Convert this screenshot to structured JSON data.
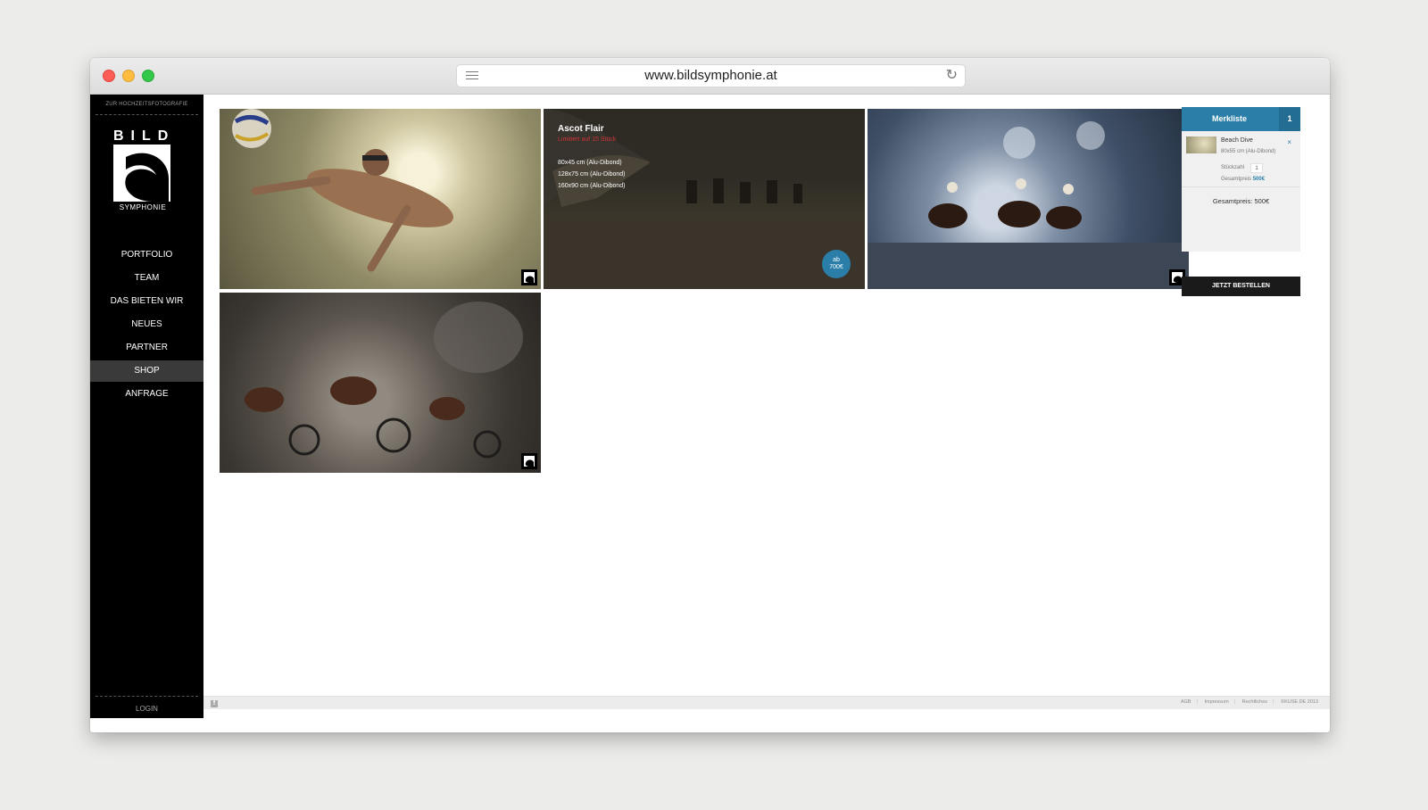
{
  "browser": {
    "url": "www.bildsymphonie.at"
  },
  "sidebar": {
    "wedding_link": "ZUR HOCHZEITSFOTOGRAFIE",
    "logo_top": "BILD",
    "logo_bottom": "SYMPHONIE",
    "nav": [
      {
        "label": "PORTFOLIO"
      },
      {
        "label": "TEAM"
      },
      {
        "label": "DAS BIETEN WIR"
      },
      {
        "label": "NEUES"
      },
      {
        "label": "PARTNER"
      },
      {
        "label": "SHOP",
        "active": true
      },
      {
        "label": "ANFRAGE"
      }
    ],
    "login": "LOGIN"
  },
  "gallery": {
    "hover_tile": {
      "title": "Ascot Flair",
      "limit": "Limitiert auf 15 Stück",
      "sizes": [
        "80x45 cm (Alu-Dibond)",
        "128x75 cm (Alu-Dibond)",
        "160x90 cm (Alu-Dibond)"
      ],
      "price_prefix": "ab",
      "price": "700€"
    }
  },
  "cart": {
    "title": "Merkliste",
    "count": "1",
    "item": {
      "name": "Beach Dive",
      "dims": "80x55 cm (Alu-Dibond)",
      "remove": "×",
      "qty_label": "Stückzahl",
      "qty": "1",
      "total_label": "Gesamtpreis",
      "total": "500€"
    },
    "grand_total": "Gesamtpreis: 500€",
    "order_button": "JETZT BESTELLEN"
  },
  "footer": {
    "fb": "f",
    "links": [
      "AGB",
      "Impressum",
      "Rechtliches",
      "©KUSE.DE 2013"
    ]
  },
  "colors": {
    "accent": "#2a7ea8",
    "limit_red": "#d0343a"
  }
}
